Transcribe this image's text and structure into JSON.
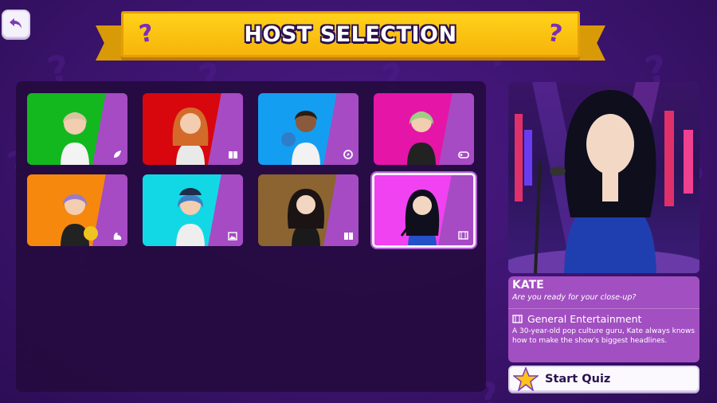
{
  "header": {
    "title": "HOST SELECTION"
  },
  "hosts": [
    {
      "color": "#13b81f",
      "category_icon": "leaf-icon"
    },
    {
      "color": "#d7070d",
      "category_icon": "book-icon"
    },
    {
      "color": "#149ef2",
      "category_icon": "compass-icon"
    },
    {
      "color": "#e515a8",
      "category_icon": "gamepad-icon"
    },
    {
      "color": "#f7880e",
      "category_icon": "muscle-icon"
    },
    {
      "color": "#12d8e6",
      "category_icon": "picture-icon"
    },
    {
      "color": "#8b6431",
      "category_icon": "book-icon"
    },
    {
      "color": "#f042f0",
      "category_icon": "film-icon",
      "selected": true
    }
  ],
  "selected_host": {
    "name": "KATE",
    "tagline": "Are you ready for your close-up?",
    "category": "General Entertainment",
    "category_icon": "film-icon",
    "description": "A 30-year-old pop culture guru, Kate always knows how to make the show's biggest headlines."
  },
  "actions": {
    "start_label": "Start Quiz"
  },
  "colors": {
    "accent": "#a24fc2",
    "banner": "#ffc814",
    "background": "#3b1470"
  }
}
